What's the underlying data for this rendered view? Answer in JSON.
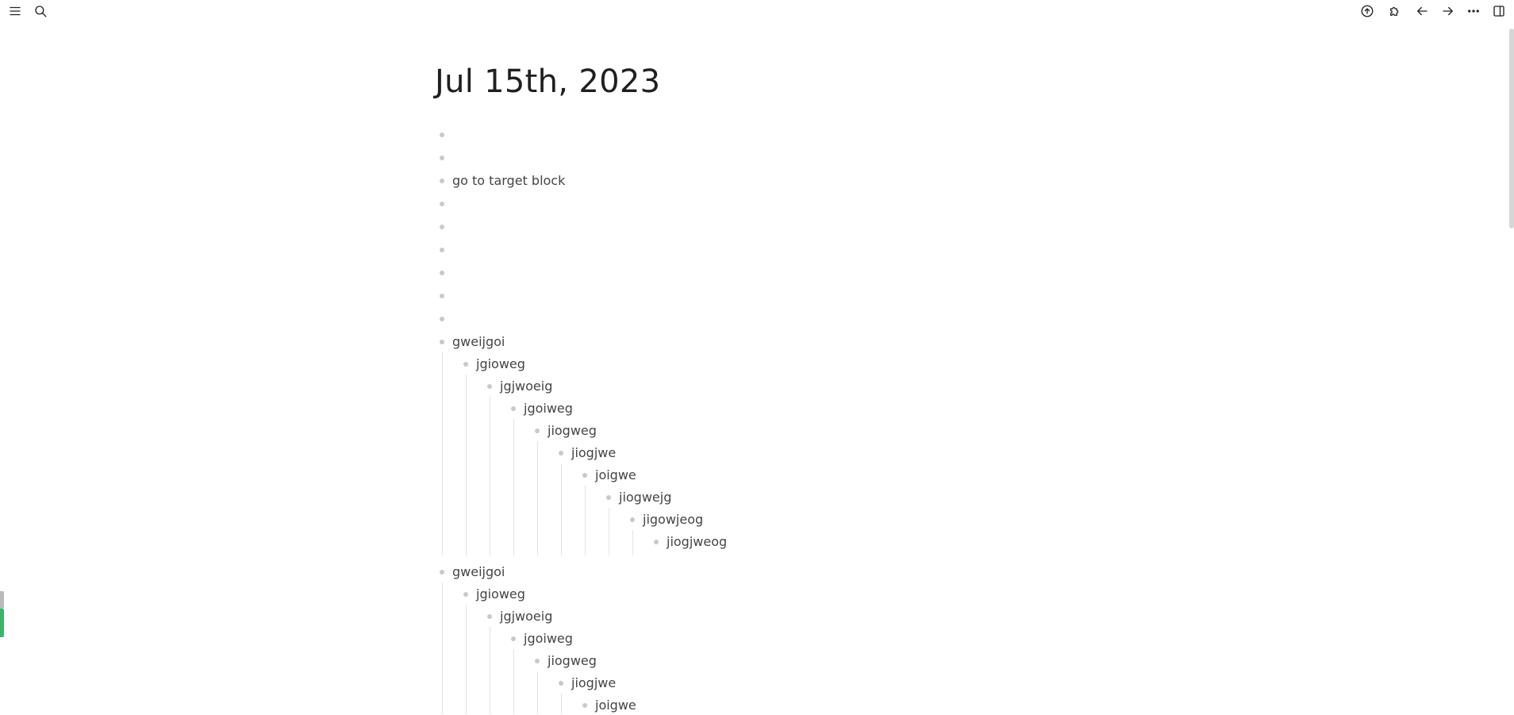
{
  "page": {
    "title": "Jul 15th, 2023"
  },
  "toolbar": {
    "left": [
      "menu-icon",
      "search-icon"
    ],
    "right": [
      "upload-icon",
      "puzzle-icon",
      "arrow-left-icon",
      "arrow-right-icon",
      "more-icon",
      "sidebar-toggle-icon"
    ]
  },
  "blocks": {
    "b0": "",
    "b1": "",
    "b2": "go to target block",
    "b3": "",
    "b4": "",
    "b5": "",
    "b6": "",
    "b7": "",
    "b8": "",
    "tree1": [
      "gweijgoi",
      "jgioweg",
      "jgjwoeig",
      "jgoiweg",
      "jiogweg",
      "jiogjwe",
      "joigwe",
      "jiogwejg",
      "jigowjeog",
      "jiogjweog"
    ],
    "tree2": [
      "gweijgoi",
      "jgioweg",
      "jgjwoeig",
      "jgoiweg",
      "jiogweg",
      "jiogjwe",
      "joigwe"
    ]
  }
}
